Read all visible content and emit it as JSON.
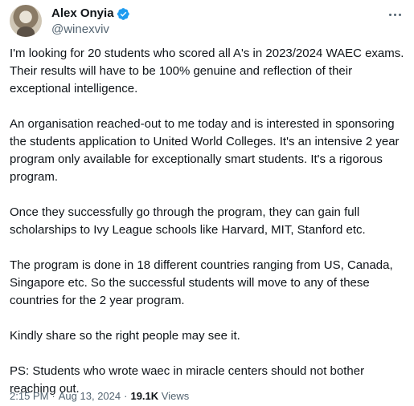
{
  "author": {
    "name": "Alex Onyia",
    "handle": "@winexviv"
  },
  "icons": {
    "verified": "verified-badge-icon",
    "more": "more-options-icon"
  },
  "colors": {
    "verified": "#1d9bf0",
    "text": "#0f1419",
    "secondary": "#536471"
  },
  "paragraphs": [
    "I'm looking for 20 students who scored all A's in 2023/2024 WAEC exams. Their results will have to be 100% genuine and reflection of their exceptional intelligence.",
    "An organisation reached-out to me today and is interested in sponsoring the students application to United World Colleges. It's an intensive 2 year program only available for exceptionally smart students. It's a rigorous program.",
    "Once they successfully go through the program, they can gain full scholarships to Ivy League schools like Harvard, MIT, Stanford etc.",
    "The program is done in 18 different countries ranging from US, Canada, Singapore etc. So the successful students will move to any of these countries for the 2 year program.",
    "Kindly share so the right people may see it.",
    "PS: Students who wrote waec in miracle centers should not bother reaching out."
  ],
  "meta": {
    "time": "2:15 PM",
    "date": "Aug 13, 2024",
    "views_count": "19.1K",
    "views_label": "Views"
  }
}
